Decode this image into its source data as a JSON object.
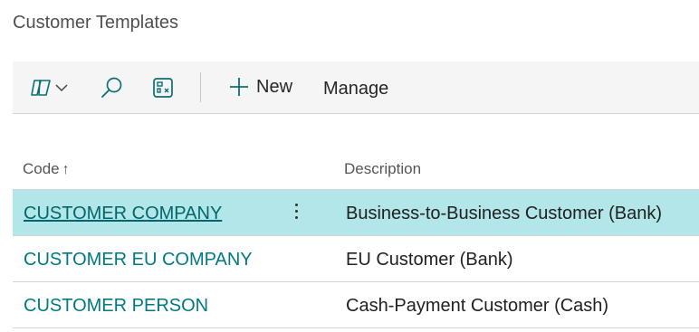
{
  "page": {
    "title": "Customer Templates"
  },
  "toolbar": {
    "copilot_icon": "copilot-icon",
    "search_icon": "search-icon",
    "personalize_icon": "personalize-icon",
    "new_label": "New",
    "manage_label": "Manage"
  },
  "table": {
    "columns": {
      "code": "Code",
      "description": "Description"
    },
    "sort_indicator": "↑",
    "rows": [
      {
        "code": "CUSTOMER COMPANY",
        "description": "Business-to-Business Customer (Bank)",
        "selected": true
      },
      {
        "code": "CUSTOMER EU COMPANY",
        "description": "EU Customer (Bank)",
        "selected": false
      },
      {
        "code": "CUSTOMER PERSON",
        "description": "Cash-Payment Customer (Cash)",
        "selected": false
      }
    ]
  },
  "colors": {
    "accent": "#007a80",
    "selected_row": "#b2e6e8",
    "toolbar_bg": "#f5f5f5"
  }
}
